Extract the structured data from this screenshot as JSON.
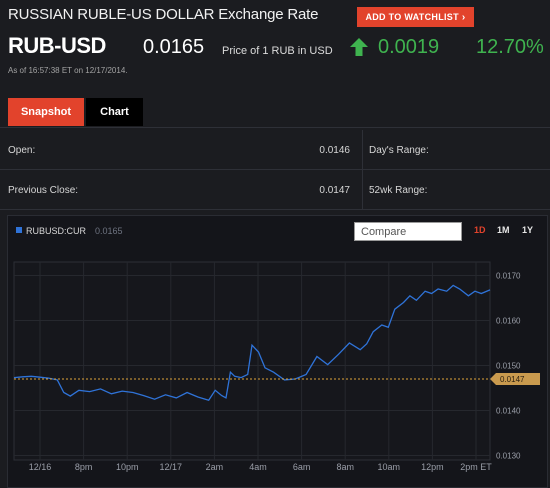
{
  "header": {
    "title": "RUSSIAN RUBLE-US DOLLAR Exchange Rate",
    "watchlist_label": "ADD TO WATCHLIST"
  },
  "quote": {
    "ticker": "RUB-USD",
    "price": "0.0165",
    "price_unit": "Price of 1 RUB in USD",
    "change": "0.0019",
    "change_pct": "12.70%",
    "direction": "up",
    "as_of": "As of 16:57:38 ET on 12/17/2014."
  },
  "tabs": [
    {
      "label": "Snapshot",
      "active": true
    },
    {
      "label": "Chart",
      "active": false
    }
  ],
  "stats": [
    {
      "label": "Open:",
      "value": "0.0146",
      "label2": "Day's Range:"
    },
    {
      "label": "Previous Close:",
      "value": "0.0147",
      "label2": "52wk Range:"
    }
  ],
  "chart_panel": {
    "series_label": "RUBUSD:CUR",
    "series_price": "0.0165",
    "compare_placeholder": "Compare",
    "ranges": [
      {
        "label": "1D",
        "active": true
      },
      {
        "label": "1M",
        "active": false
      },
      {
        "label": "1Y",
        "active": false
      }
    ]
  },
  "colors": {
    "accent": "#e2432c",
    "positive": "#3fb34f",
    "series_line": "#2f73d8",
    "prev_close_line": "#e0a43a"
  },
  "icons": {
    "change_direction": "up-arrow-icon"
  },
  "chart_data": {
    "type": "line",
    "title": "",
    "x_ticks": [
      "12/16",
      "8pm",
      "10pm",
      "12/17",
      "2am",
      "4am",
      "6am",
      "8am",
      "10am",
      "12pm",
      "2pm ET"
    ],
    "y_ticks": [
      0.017,
      0.016,
      0.015,
      0.014,
      0.013
    ],
    "y_tick_labels": [
      "0.0170",
      "0.0160",
      "0.0150",
      "0.0140",
      "0.0130"
    ],
    "ylim": [
      0.0129,
      0.0173
    ],
    "xlim": [
      0,
      22
    ],
    "x_unit": "hours since 12/16 4pm ET",
    "reference_line": {
      "value": 0.0147,
      "label": "0.0147"
    },
    "grid": true,
    "series": [
      {
        "x": [
          0,
          0.4,
          0.8,
          1.2,
          1.6,
          2.0,
          2.3,
          2.6,
          3.0,
          3.5,
          4.0,
          4.5,
          5.0,
          5.5,
          6.0,
          6.5,
          7.0,
          7.5,
          8.0,
          8.5,
          9.0,
          9.3,
          9.6,
          9.8,
          10.0,
          10.2,
          10.5,
          10.8,
          11.0,
          11.3,
          11.6,
          12.0,
          12.5,
          13.0,
          13.5,
          14.0,
          14.5,
          15.0,
          15.5,
          16.0,
          16.3,
          16.6,
          17.0,
          17.3,
          17.6,
          18.0,
          18.3,
          18.6,
          19.0,
          19.3,
          19.6,
          20.0,
          20.3,
          20.6,
          21.0,
          21.3,
          21.6,
          22.0
        ],
        "y": [
          0.01473,
          0.01475,
          0.01476,
          0.01474,
          0.01472,
          0.01468,
          0.0144,
          0.01432,
          0.01445,
          0.01442,
          0.01448,
          0.01437,
          0.01443,
          0.0144,
          0.01433,
          0.01425,
          0.01435,
          0.01428,
          0.0144,
          0.0143,
          0.01423,
          0.01445,
          0.01433,
          0.01428,
          0.01485,
          0.01476,
          0.01473,
          0.0148,
          0.01545,
          0.0153,
          0.01495,
          0.01485,
          0.01468,
          0.0147,
          0.0148,
          0.0152,
          0.01502,
          0.01525,
          0.0155,
          0.01535,
          0.01548,
          0.01575,
          0.0159,
          0.01585,
          0.01625,
          0.0164,
          0.01655,
          0.01645,
          0.01665,
          0.0166,
          0.0167,
          0.01665,
          0.01678,
          0.0167,
          0.01655,
          0.01665,
          0.0166,
          0.01668
        ]
      }
    ]
  }
}
